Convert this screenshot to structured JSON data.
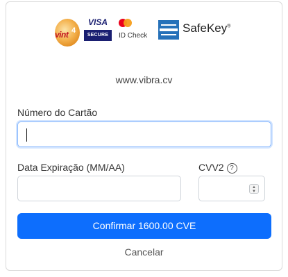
{
  "logos": {
    "vint4": {
      "text": "vint",
      "number": "4"
    },
    "visa": {
      "word": "VISA",
      "secure": "SECURE"
    },
    "mastercard": {
      "caption": "ID Check"
    },
    "safekey": {
      "text": "SafeKey",
      "mark": "®"
    }
  },
  "merchant_url": "www.vibra.cv",
  "card_number": {
    "label": "Número do Cartão",
    "value": ""
  },
  "expiry": {
    "label": "Data Expiração (MM/AA)",
    "value": ""
  },
  "cvv": {
    "label": "CVV2",
    "help_icon": "?",
    "value": ""
  },
  "confirm_button": "Confirmar 1600.00 CVE",
  "cancel_link": "Cancelar",
  "colors": {
    "primary": "#0d6efd",
    "focus_border": "#86b7fe"
  }
}
